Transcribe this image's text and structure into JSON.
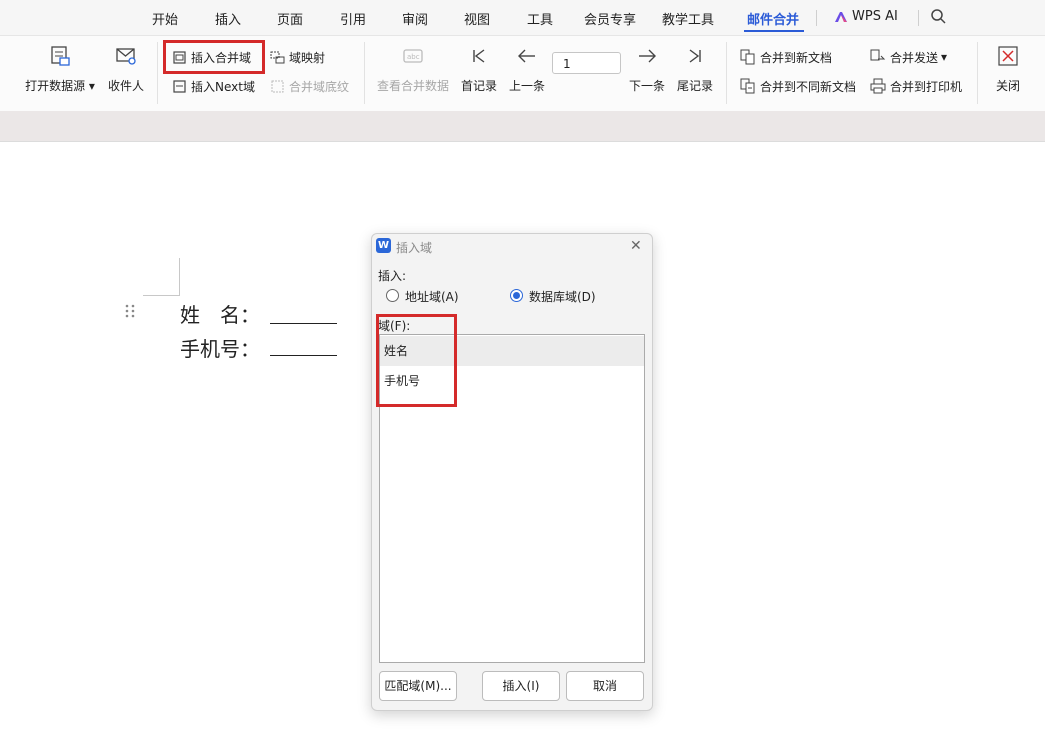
{
  "tabs": [
    {
      "label": "开始"
    },
    {
      "label": "插入"
    },
    {
      "label": "页面"
    },
    {
      "label": "引用"
    },
    {
      "label": "审阅"
    },
    {
      "label": "视图"
    },
    {
      "label": "工具"
    },
    {
      "label": "会员专享"
    },
    {
      "label": "教学工具"
    },
    {
      "label": "邮件合并"
    },
    {
      "label": "WPS AI"
    }
  ],
  "ribbon": {
    "open_datasource": "打开数据源",
    "recipients": "收件人",
    "insert_merge_field": "插入合并域",
    "field_mapping": "域映射",
    "insert_next": "插入Next域",
    "merge_field_shading": "合并域底纹",
    "view_merged_data": "查看合并数据",
    "first_record": "首记录",
    "prev_record": "上一条",
    "record_number": "1",
    "next_record": "下一条",
    "last_record": "尾记录",
    "merge_to_new_doc": "合并到新文档",
    "merge_to_diff_docs": "合并到不同新文档",
    "merge_send": "合并发送",
    "merge_to_printer": "合并到打印机",
    "close": "关闭"
  },
  "document": {
    "line1": "姓　名：",
    "line2": "手机号："
  },
  "dialog": {
    "title": "插入域",
    "insert_label": "插入:",
    "option_address": "地址域(A)",
    "option_database": "数据库域(D)",
    "field_label": "域(F):",
    "fields": [
      "姓名",
      "手机号"
    ],
    "match_button": "匹配域(M)...",
    "insert_button": "插入(I)",
    "cancel_button": "取消"
  },
  "colors": {
    "accent": "#2b5bd7",
    "highlight": "#d42a2a"
  }
}
